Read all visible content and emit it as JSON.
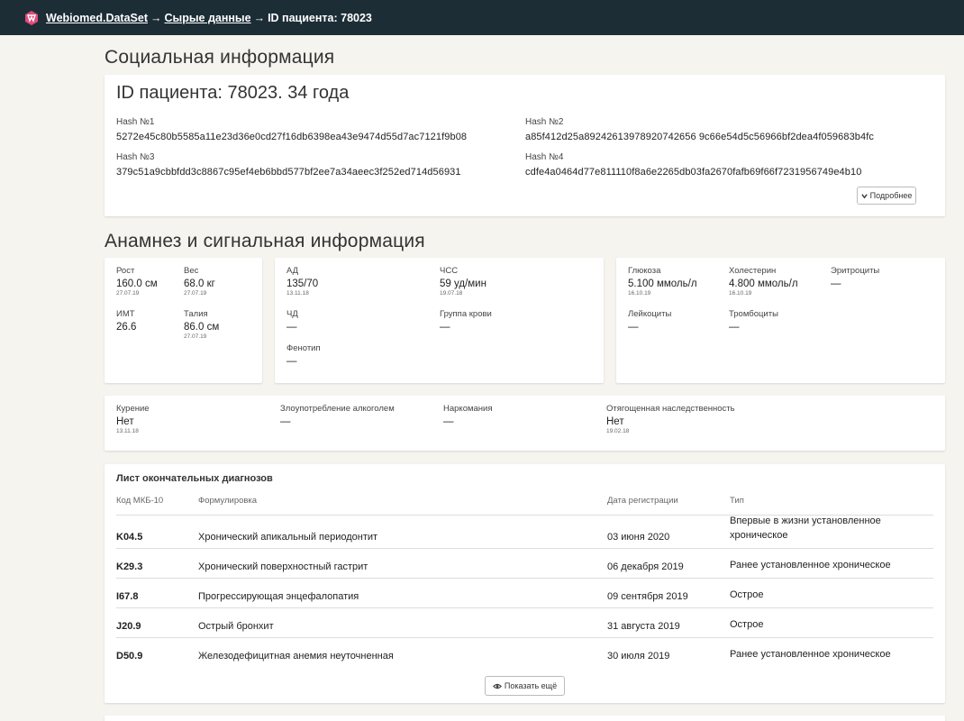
{
  "header": {
    "app_name": "Webiomed.DataSet",
    "arrow": "→",
    "crumb_raw": "Сырые данные",
    "crumb_patient": "ID пациента: 78023"
  },
  "social": {
    "section_title": "Социальная информация",
    "patient_title": "ID пациента: 78023. 34 года",
    "hashes": [
      {
        "label": "Hash №1",
        "value": "5272e45c80b5585a11e23d36e0cd27f16db6398ea43e9474d55d7ac7121f9b08"
      },
      {
        "label": "Hash №2",
        "value": "a85f412d25a89242613978920742656 9c66e54d5c56966bf2dea4f059683b4fc"
      },
      {
        "label": "Hash №3",
        "value": "379c51a9cbbfdd3c8867c95ef4eb6bbd577bf2ee7a34aeec3f252ed714d56931"
      },
      {
        "label": "Hash №4",
        "value": "cdfe4a0464d77e811110f8a6e2265db03fa2670fafb69f66f7231956749e4b10"
      }
    ],
    "more_button": "Подробнее"
  },
  "anamnesis": {
    "section_title": "Анамнез и сигнальная информация",
    "body": [
      {
        "label": "Рост",
        "value": "160.0 см",
        "date": "27.07.19"
      },
      {
        "label": "Вес",
        "value": "68.0 кг",
        "date": "27.07.19"
      },
      {
        "label": "ИМТ",
        "value": "26.6",
        "date": ""
      },
      {
        "label": "Талия",
        "value": "86.0 см",
        "date": "27.07.19"
      }
    ],
    "vitals": [
      {
        "label": "АД",
        "value": "135/70",
        "date": "13.11.18"
      },
      {
        "label": "ЧСС",
        "value": "59 уд/мин",
        "date": "19.07.18"
      },
      {
        "label": "ЧД",
        "value": "—",
        "date": ""
      },
      {
        "label": "Группа крови",
        "value": "—",
        "date": ""
      },
      {
        "label": "Фенотип",
        "value": "—",
        "date": ""
      }
    ],
    "labs": [
      {
        "label": "Глюкоза",
        "value": "5.100 ммоль/л",
        "date": "16.10.19"
      },
      {
        "label": "Холестерин",
        "value": "4.800 ммоль/л",
        "date": "16.10.19"
      },
      {
        "label": "Эритроциты",
        "value": "—",
        "date": ""
      },
      {
        "label": "Лейкоциты",
        "value": "—",
        "date": ""
      },
      {
        "label": "Тромбоциты",
        "value": "—",
        "date": ""
      }
    ],
    "habits": [
      {
        "label": "Курение",
        "value": "Нет",
        "date": "13.11.18"
      },
      {
        "label": "Злоупотребление алкоголем",
        "value": "—",
        "date": ""
      },
      {
        "label": "Наркомания",
        "value": "—",
        "date": ""
      },
      {
        "label": "Отягощенная наследственность",
        "value": "Нет",
        "date": "19.02.18"
      }
    ]
  },
  "diagnoses": {
    "title": "Лист окончательных диагнозов",
    "columns": {
      "code": "Код МКБ-10",
      "formulation": "Формулировка",
      "date": "Дата регистрации",
      "type": "Тип"
    },
    "rows": [
      {
        "code": "K04.5",
        "formulation": "Хронический апикальный периодонтит",
        "date": "03 июня 2020",
        "type": "Впервые в жизни установленное хроническое"
      },
      {
        "code": "K29.3",
        "formulation": "Хронический поверхностный гастрит",
        "date": "06 декабря 2019",
        "type": "Ранее установленное хроническое"
      },
      {
        "code": "I67.8",
        "formulation": "Прогрессирующая энцефалопатия",
        "date": "09 сентября 2019",
        "type": "Острое"
      },
      {
        "code": "J20.9",
        "formulation": "Острый бронхит",
        "date": "31 августа 2019",
        "type": "Острое"
      },
      {
        "code": "D50.9",
        "formulation": "Железодефицитная анемия неуточненная",
        "date": "30 июля 2019",
        "type": "Ранее установленное хроническое"
      }
    ],
    "show_more_button": "Показать ещё"
  }
}
